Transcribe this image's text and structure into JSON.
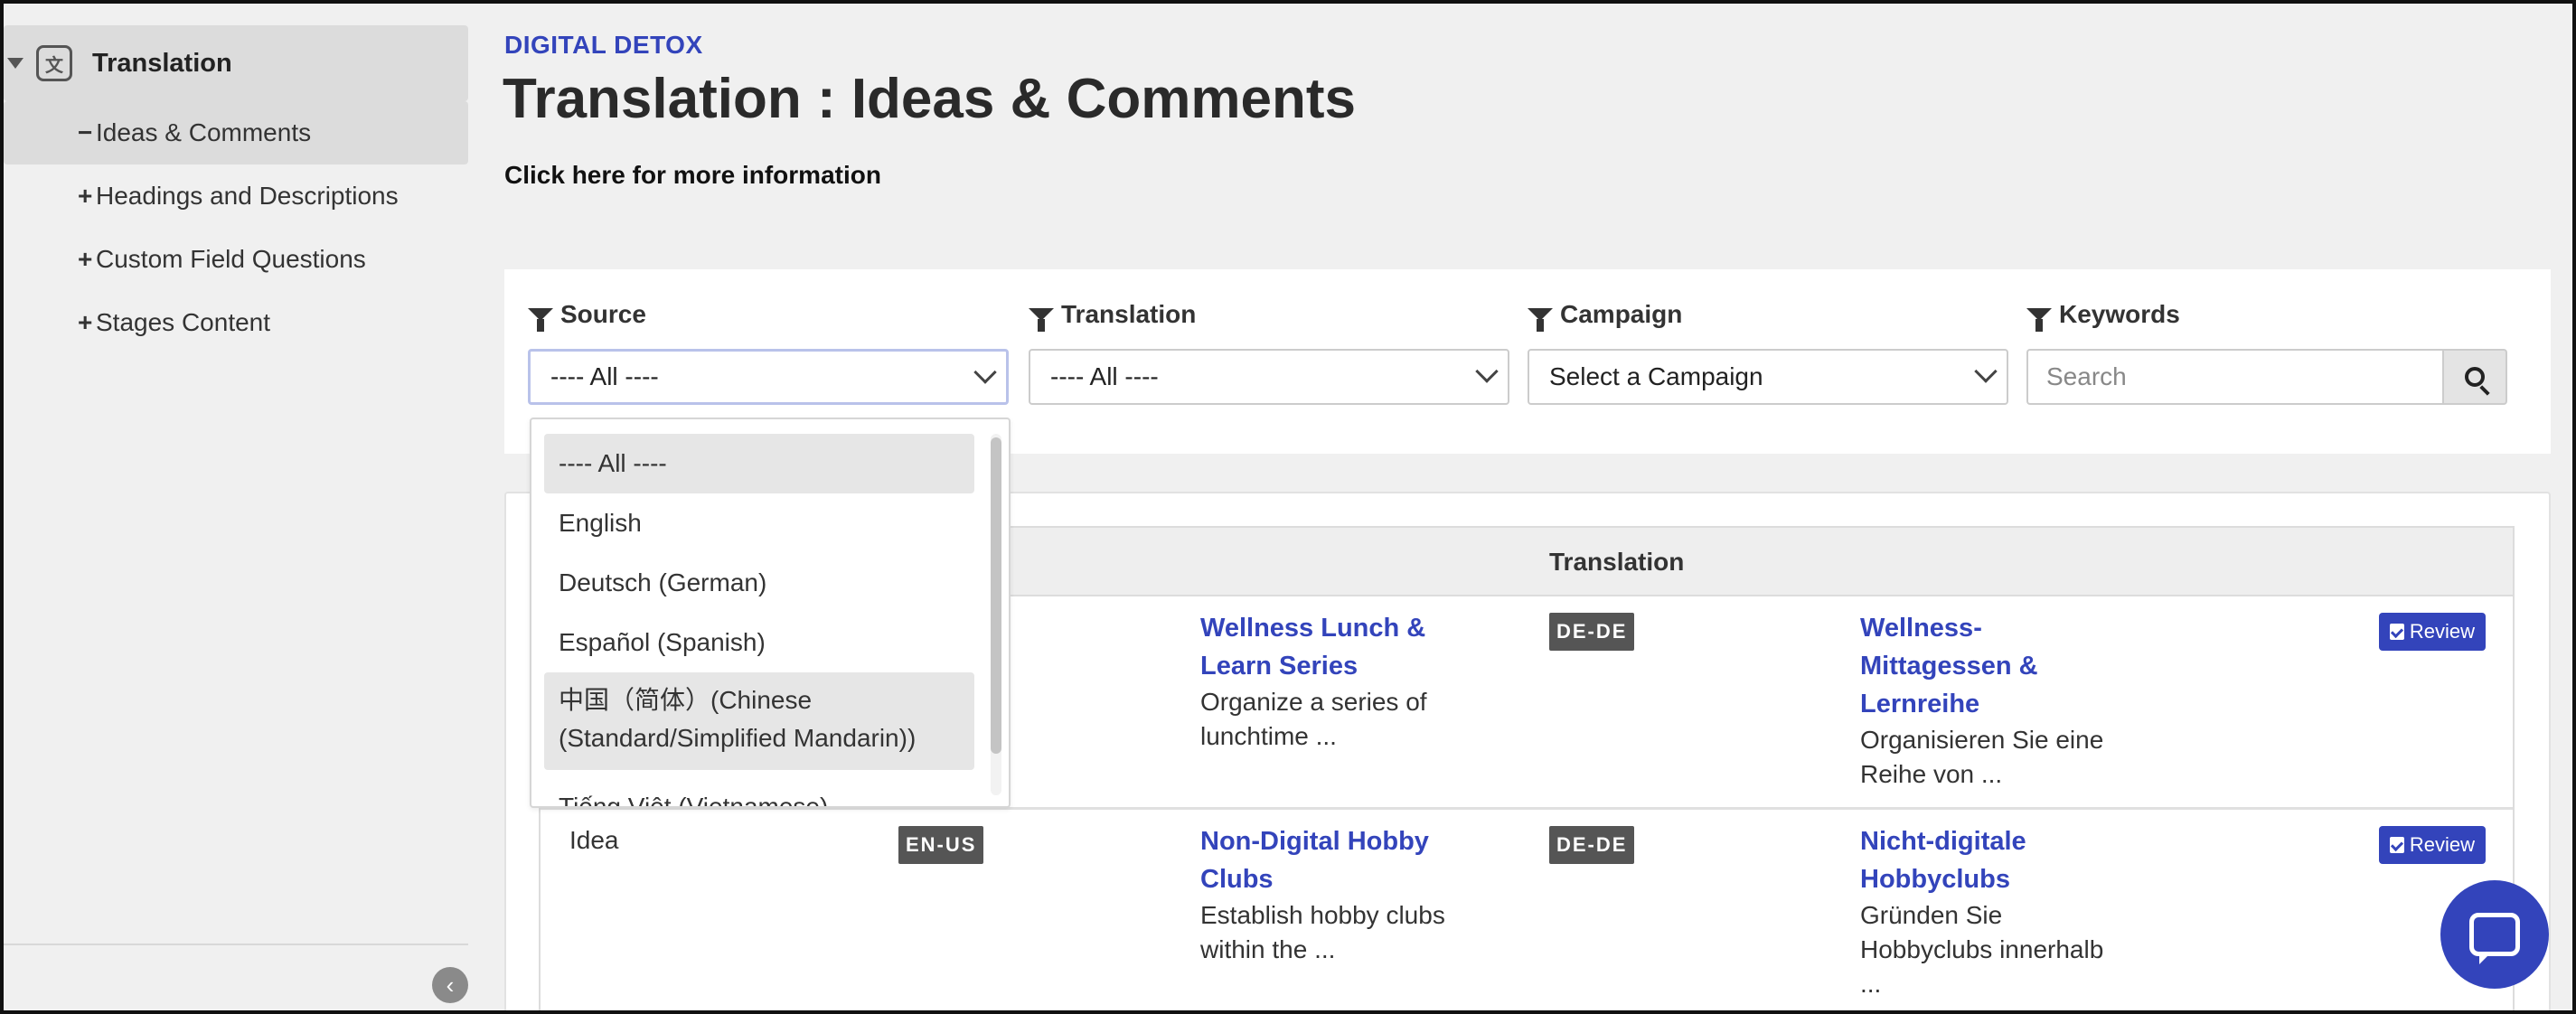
{
  "sidebar": {
    "root_label": "Translation",
    "items": [
      {
        "sign": "−",
        "label": "Ideas & Comments"
      },
      {
        "sign": "+",
        "label": "Headings and Descriptions"
      },
      {
        "sign": "+",
        "label": "Custom Field Questions"
      },
      {
        "sign": "+",
        "label": "Stages Content"
      }
    ],
    "collapse_icon": "‹"
  },
  "header": {
    "breadcrumb": "DIGITAL DETOX",
    "title": "Translation : Ideas & Comments",
    "more_info": "Click here for more information"
  },
  "filters": {
    "source": {
      "label": "Source",
      "value": "---- All ----"
    },
    "translation": {
      "label": "Translation",
      "value": "---- All ----"
    },
    "campaign": {
      "label": "Campaign",
      "value": "Select a Campaign"
    },
    "keywords": {
      "label": "Keywords",
      "placeholder": "Search"
    }
  },
  "dropdown": {
    "options": [
      "---- All ----",
      "English",
      "Deutsch (German)",
      "Español (Spanish)",
      "中国（简体）(Chinese",
      "(Standard/Simplified Mandarin))",
      "Tiếng Việt (Vietnamese)"
    ]
  },
  "table": {
    "header_translation": "Translation",
    "rows": [
      {
        "type": "",
        "source_lang": "",
        "source_title_1": "Wellness Lunch &",
        "source_title_2": "Learn Series",
        "source_desc_1": "Organize a series of",
        "source_desc_2": "lunchtime ...",
        "target_lang": "DE-DE",
        "target_title_1": "Wellness-",
        "target_title_2": "Mittagessen &",
        "target_title_3": "Lernreihe",
        "target_desc_1": "Organisieren Sie eine",
        "target_desc_2": "Reihe von ...",
        "review": "Review"
      },
      {
        "type": "Idea",
        "source_lang": "EN-US",
        "source_title_1": "Non-Digital Hobby",
        "source_title_2": "Clubs",
        "source_desc_1": "Establish hobby clubs",
        "source_desc_2": "within the ...",
        "target_lang": "DE-DE",
        "target_title_1": "Nicht-digitale",
        "target_title_2": "Hobbyclubs",
        "target_desc_1": "Gründen Sie",
        "target_desc_2": "Hobbyclubs innerhalb",
        "target_desc_3": "...",
        "review": "Review"
      }
    ]
  },
  "colors": {
    "accent": "#3344bb",
    "badge": "#555555",
    "highlight": "#e6e6e6"
  }
}
